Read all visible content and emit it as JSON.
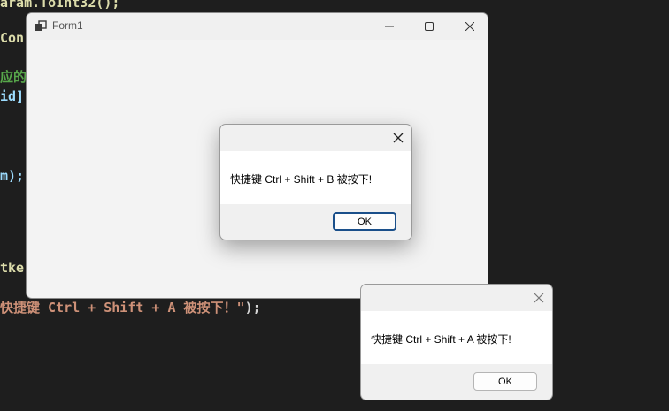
{
  "code": {
    "line1": "aram.ToInt32();",
    "line2": "Con",
    "line3": "应的",
    "line4": "id]",
    "line5": "m);",
    "line6": "tke",
    "line7_str": "快捷键 Ctrl + Shift + A 被按下！\"",
    "line7_end": ");"
  },
  "form1": {
    "title": "Form1",
    "icons": {
      "app": "app-icon",
      "minimize": "minimize-icon",
      "maximize": "maximize-icon",
      "close": "close-icon"
    }
  },
  "dialog_b": {
    "message": "快捷键 Ctrl + Shift + B 被按下!",
    "ok_label": "OK"
  },
  "dialog_a": {
    "message": "快捷键 Ctrl + Shift + A 被按下!",
    "ok_label": "OK"
  }
}
